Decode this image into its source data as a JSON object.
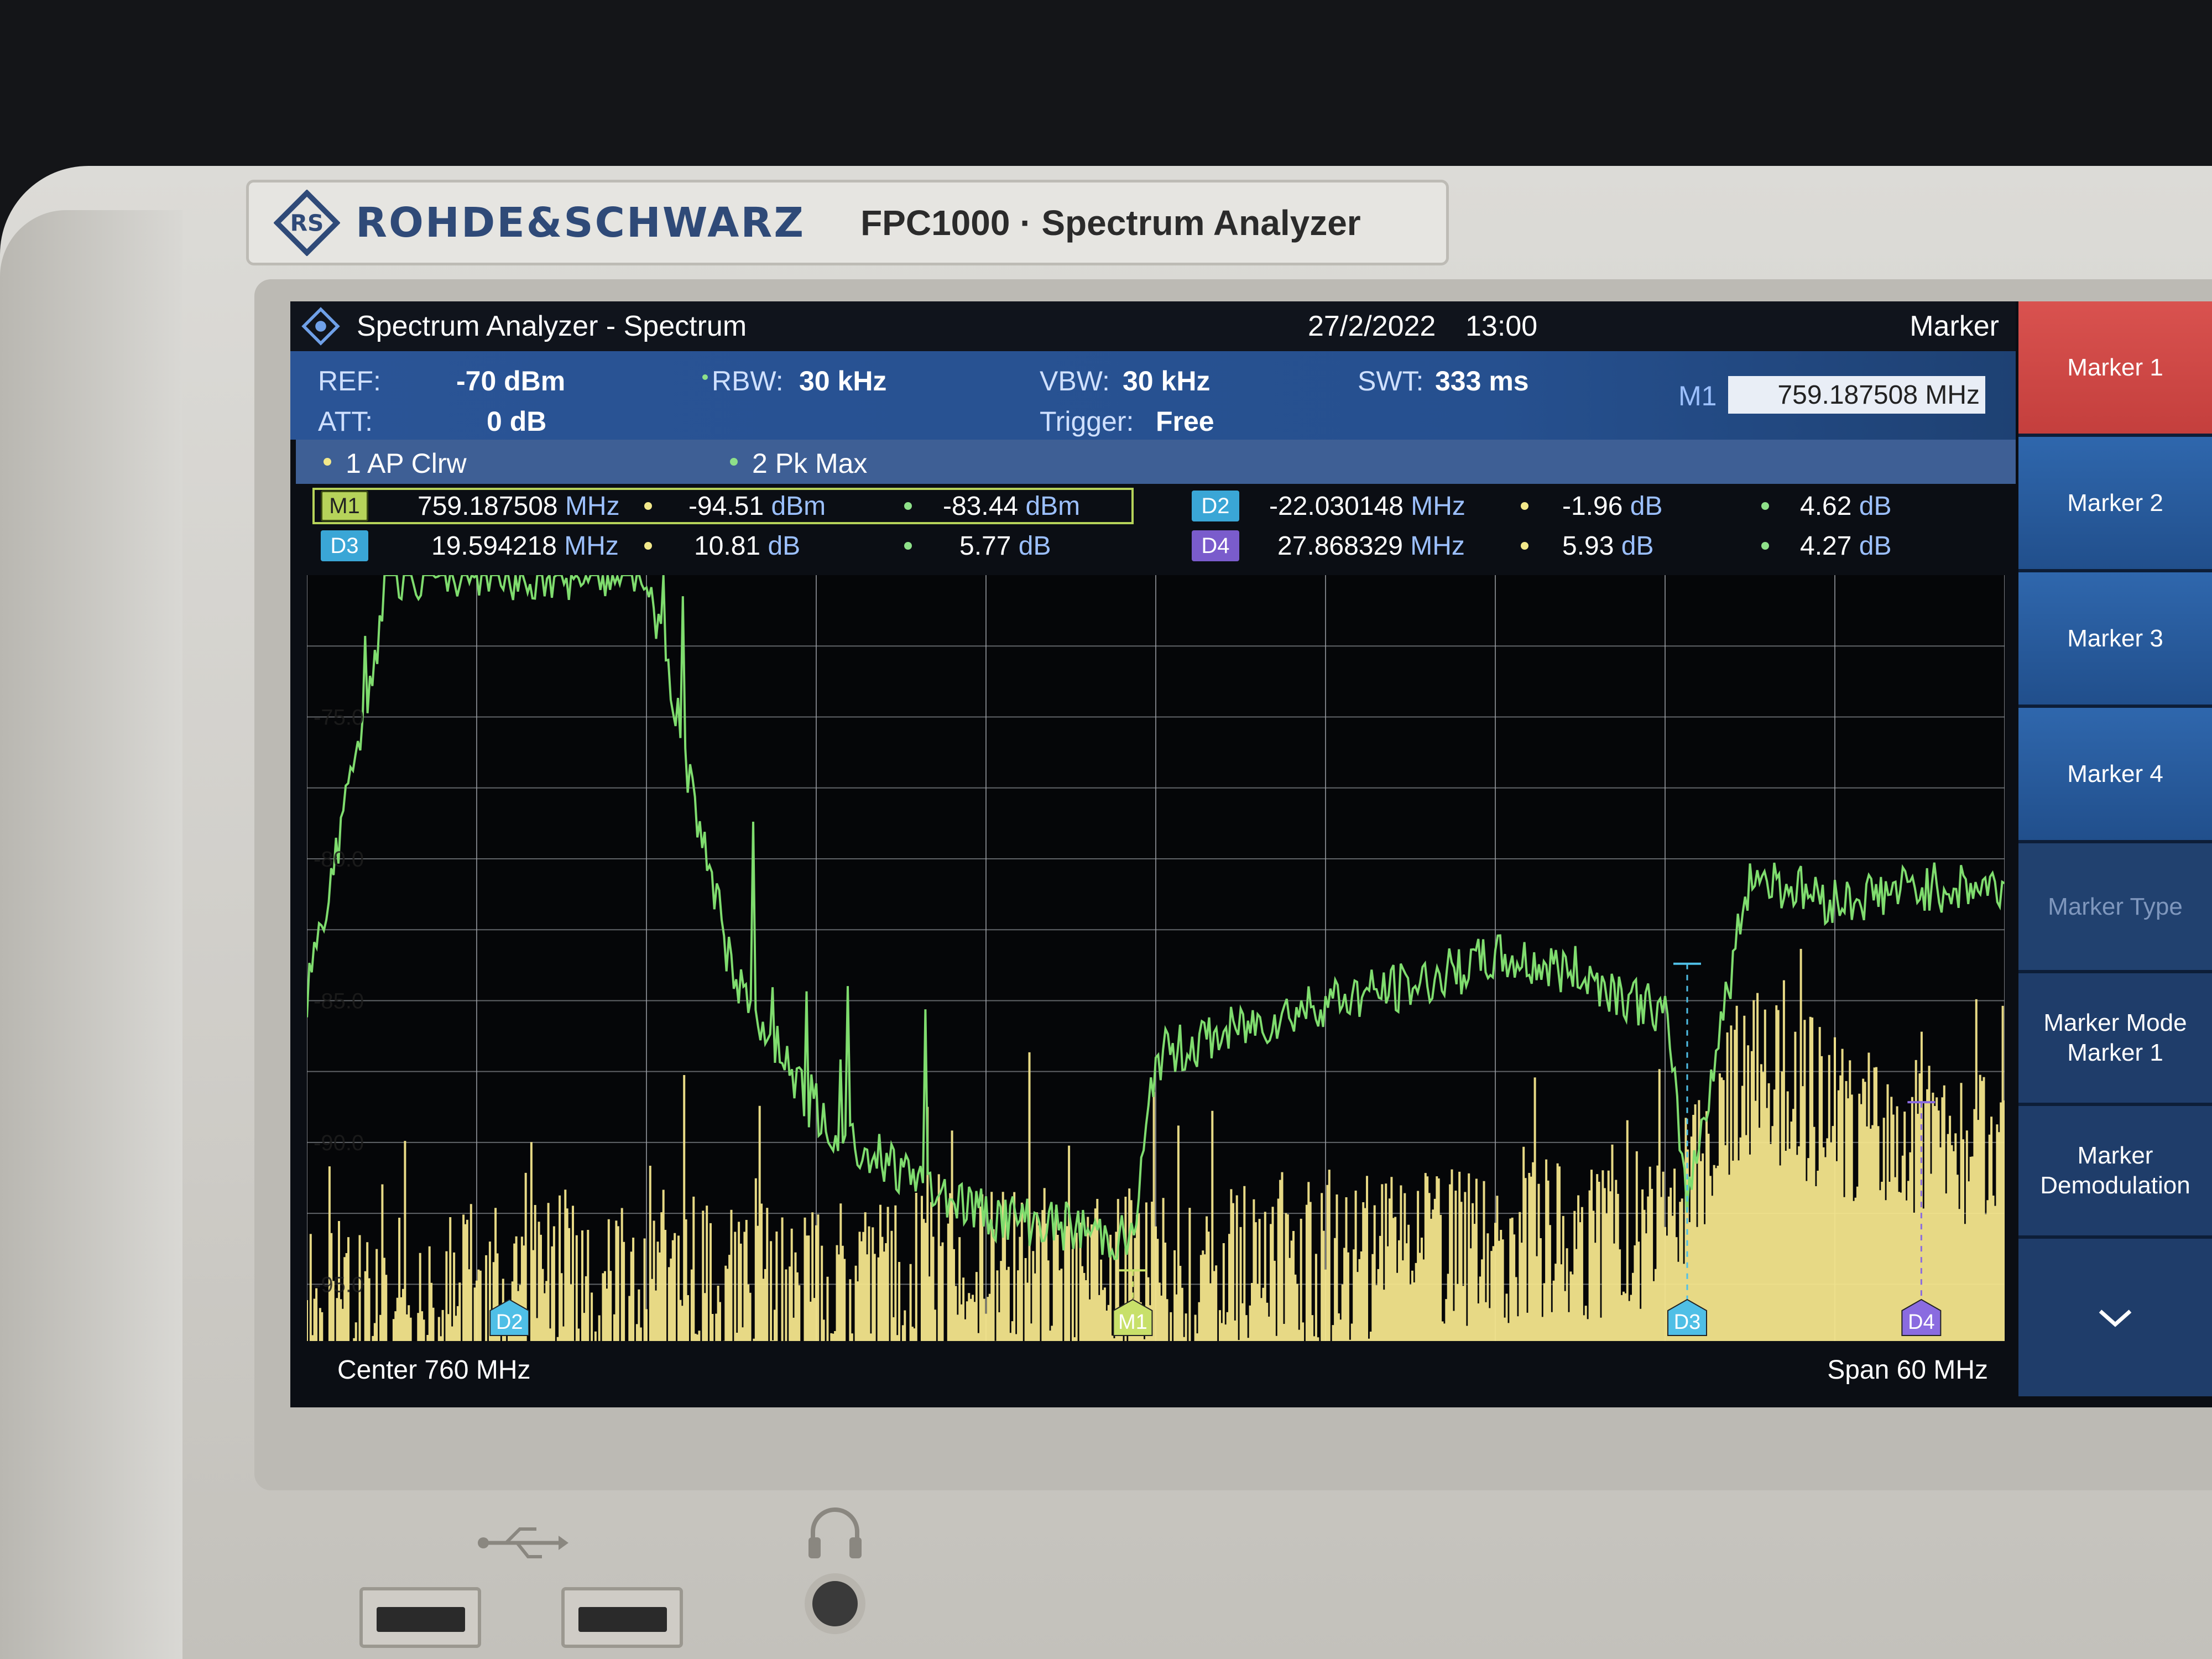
{
  "device": {
    "brand": "ROHDE&SCHWARZ",
    "model": "FPC1000 · Spectrum Analyzer"
  },
  "title_bar": {
    "app_title": "Spectrum Analyzer - Spectrum",
    "date": "27/2/2022",
    "time": "13:00",
    "panel": "Marker"
  },
  "settings": {
    "ref_label": "REF:",
    "ref_value": "-70 dBm",
    "att_label": "ATT:",
    "att_value": "0 dB",
    "rbw_label": "RBW:",
    "rbw_value": "30 kHz",
    "vbw_label": "VBW:",
    "vbw_value": "30 kHz",
    "trigger_label": "Trigger:",
    "trigger_value": "Free",
    "swt_label": "SWT:",
    "swt_value": "333 ms",
    "m1_label": "M1",
    "m1_freq": "759.187508 MHz"
  },
  "traces": {
    "trace1": "1 AP  Clrw",
    "trace2": "2 Pk  Max"
  },
  "markers": {
    "m1": {
      "tag": "M1",
      "freq": "759.187508",
      "freq_unit": "MHz",
      "v1": "-94.51",
      "v1_unit": "dBm",
      "v2": "-83.44",
      "v2_unit": "dBm"
    },
    "d2": {
      "tag": "D2",
      "freq": "-22.030148",
      "freq_unit": "MHz",
      "v1": "-1.96",
      "v1_unit": "dB",
      "v2": "4.62",
      "v2_unit": "dB"
    },
    "d3": {
      "tag": "D3",
      "freq": "19.594218",
      "freq_unit": "MHz",
      "v1": "10.81",
      "v1_unit": "dB",
      "v2": "5.77",
      "v2_unit": "dB"
    },
    "d4": {
      "tag": "D4",
      "freq": "27.868329",
      "freq_unit": "MHz",
      "v1": "5.93",
      "v1_unit": "dB",
      "v2": "4.27",
      "v2_unit": "dB"
    }
  },
  "footer": {
    "center": "Center 760 MHz",
    "span": "Span 60 MHz"
  },
  "softkeys": [
    {
      "label": "Marker 1",
      "state": "active"
    },
    {
      "label": "Marker 2",
      "state": "normal"
    },
    {
      "label": "Marker 3",
      "state": "normal"
    },
    {
      "label": "Marker 4",
      "state": "normal"
    },
    {
      "label": "Marker Type",
      "state": "disabled"
    },
    {
      "label": "Marker Mode\nMarker 1",
      "state": "normal"
    },
    {
      "label": "Marker\nDemodulation",
      "state": "normal"
    }
  ],
  "chart_data": {
    "type": "line",
    "title": "",
    "xlabel": "Center 760 MHz",
    "ylabel": "",
    "x_center_mhz": 760,
    "x_span_mhz": 60,
    "xlim": [
      730,
      790
    ],
    "ylim": [
      -97,
      -70
    ],
    "ytick_labels": [
      "-75.0",
      "-80.0",
      "-85.0",
      "-90.0",
      "-95.0"
    ],
    "yticks": [
      -75,
      -80,
      -85,
      -90,
      -95
    ],
    "grid": true,
    "series": [
      {
        "name": "1 AP  Clrw",
        "color": "#f3e58c",
        "x": [
          730,
          733,
          736,
          739,
          742,
          745,
          748,
          751,
          754,
          757,
          760,
          763,
          766,
          769,
          772,
          775,
          778,
          781,
          784,
          787,
          790
        ],
        "y": [
          -96,
          -96,
          -95.5,
          -95.5,
          -95.8,
          -95.6,
          -95.4,
          -95.2,
          -95.2,
          -95.1,
          -95,
          -94.8,
          -94.6,
          -94.4,
          -94.2,
          -93.8,
          -93.5,
          -88,
          -89.5,
          -90.5,
          -91
        ]
      },
      {
        "name": "2 Pk  Max",
        "color": "#7fdc6e",
        "x": [
          730,
          733,
          736,
          739,
          742,
          745,
          748,
          751,
          754,
          757,
          759.2,
          760,
          763,
          766,
          769,
          772,
          775,
          778,
          778.8,
          781,
          784,
          787,
          790
        ],
        "y": [
          -85,
          -70,
          -70,
          -70,
          -70,
          -84,
          -89,
          -91,
          -92.5,
          -93,
          -93.5,
          -87,
          -86,
          -85,
          -84.5,
          -83.5,
          -84,
          -85.5,
          -92,
          -80.5,
          -81.5,
          -81,
          -81
        ]
      }
    ],
    "markers": [
      {
        "name": "M1",
        "x": 759.187508,
        "y": -94.51
      },
      {
        "name": "D2",
        "x": 737.15736,
        "y": -96.47
      },
      {
        "name": "D3",
        "x": 778.781726,
        "y": -83.7
      },
      {
        "name": "D4",
        "x": 787.055837,
        "y": -88.58
      }
    ]
  }
}
